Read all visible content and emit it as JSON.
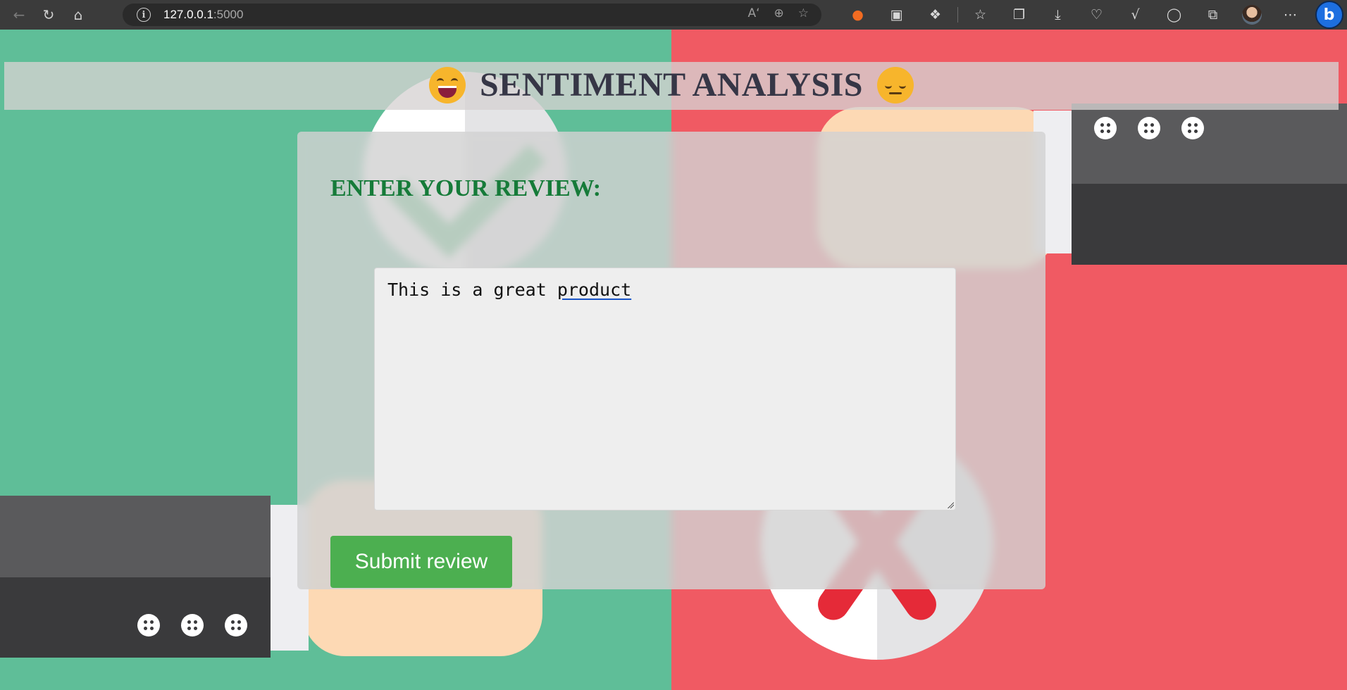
{
  "browser": {
    "url_host": "127.0.0.1",
    "url_port": ":5000",
    "nav_icons": [
      "back-icon",
      "refresh-icon",
      "home-icon"
    ],
    "address_icons": [
      "read-aloud-icon",
      "zoom-icon",
      "favorite-add-icon"
    ],
    "toolbar_icons": [
      "extension-orange-icon",
      "screen-cast-icon",
      "extensions-icon",
      "favorites-icon",
      "collections-icon",
      "downloads-icon",
      "performance-icon",
      "math-solver-icon",
      "browser-essentials-icon",
      "screenshot-icon",
      "profile-avatar",
      "more-icon",
      "bing-copilot-icon"
    ]
  },
  "header": {
    "title": "SENTIMENT ANALYSIS",
    "left_emoji": "grinning-face-icon",
    "right_emoji": "pensive-face-icon"
  },
  "form": {
    "heading": "ENTER YOUR REVIEW:",
    "review_text_plain": "This is a great ",
    "review_text_flagged": "product",
    "submit_label": "Submit review"
  },
  "colors": {
    "left_bg": "#5fbe98",
    "right_bg": "#f05a63",
    "heading": "#167b39",
    "button": "#4caf50",
    "title": "#363646"
  }
}
